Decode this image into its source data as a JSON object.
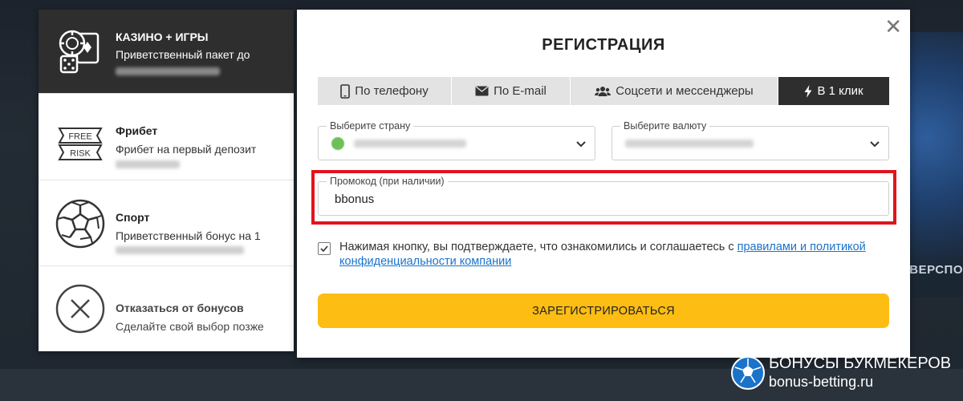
{
  "left_panel": {
    "items": [
      {
        "title": "КАЗИНО + ИГРЫ",
        "desc": "Приветственный пакет до",
        "icon": "casino-chips-cards-icon"
      },
      {
        "title": "Фрибет",
        "desc": "Фрибет на первый депозит",
        "icon_top": "FREE",
        "icon_bottom": "RISK",
        "icon": "freebet-ticket-icon"
      },
      {
        "title": "Спорт",
        "desc": "Приветственный бонус на 1",
        "icon": "soccer-ball-icon"
      },
      {
        "title": "Отказаться от бонусов",
        "desc": "Сделайте свой выбор позже",
        "icon": "close-circle-icon"
      }
    ]
  },
  "modal": {
    "title": "РЕГИСТРАЦИЯ",
    "close": "✕",
    "tabs": [
      {
        "label": "По телефону",
        "icon": "phone-icon"
      },
      {
        "label": "По E-mail",
        "icon": "envelope-icon"
      },
      {
        "label": "Соцсети и мессенджеры",
        "icon": "users-icon"
      },
      {
        "label": "В 1 клик",
        "icon": "lightning-icon",
        "active": true
      }
    ],
    "country_label": "Выберите страну",
    "currency_label": "Выберите валюту",
    "promo_label": "Промокод (при наличии)",
    "promo_value": "bbonus",
    "agree_text": "Нажимая кнопку, вы подтверждаете, что ознакомились и соглашаетесь с ",
    "agree_link": "правилами и политикой конфиденциальности компании",
    "submit": "ЗАРЕГИСТРИРОВАТЬСЯ"
  },
  "background": {
    "text": "ВЕРСПО"
  },
  "watermark": {
    "line1": "БОНУСЫ БУКМЕКЕРОВ",
    "line2": "bonus-betting.ru"
  },
  "colors": {
    "accent": "#fdbd12",
    "highlight": "#e0141e",
    "link": "#1a73c9",
    "dark": "#2e2e2e"
  }
}
